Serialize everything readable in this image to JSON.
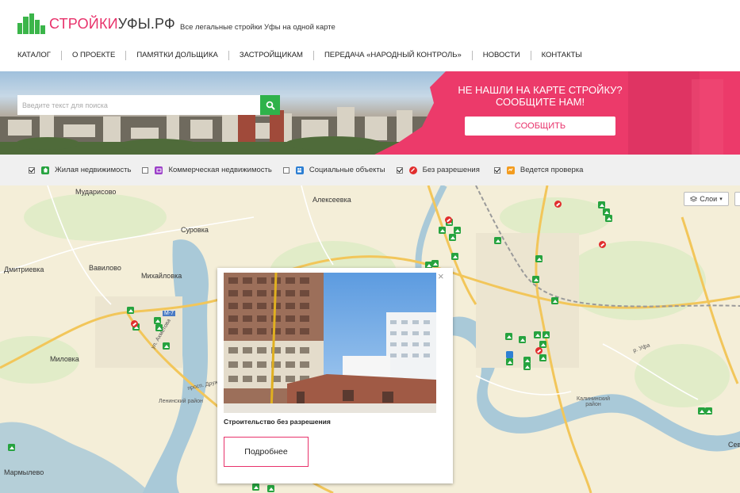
{
  "header": {
    "logo_part1": "СТРОЙКИ",
    "logo_part2": "УФЫ.РФ",
    "tagline": "Все легальные стройки Уфы на одной карте"
  },
  "nav": [
    {
      "label": "КАТАЛОГ"
    },
    {
      "label": "О ПРОЕКТЕ"
    },
    {
      "label": "ПАМЯТКИ ДОЛЬЩИКА"
    },
    {
      "label": "ЗАСТРОЙЩИКАМ"
    },
    {
      "label": "ПЕРЕДАЧА «НАРОДНЫЙ КОНТРОЛЬ»"
    },
    {
      "label": "НОВОСТИ"
    },
    {
      "label": "КОНТАКТЫ"
    }
  ],
  "search": {
    "placeholder": "Введите текст для поиска",
    "icon": "search-icon"
  },
  "promo": {
    "title": "НЕ НАШЛИ НА КАРТЕ СТРОЙКУ? СООБЩИТЕ НАМ!",
    "button": "СООБЩИТЬ"
  },
  "filters": [
    {
      "label": "Жилая недвижимость",
      "checked": true,
      "icon": "house-icon",
      "color": "#26a33f"
    },
    {
      "label": "Коммерческая недвижимость",
      "checked": false,
      "icon": "shop-icon",
      "color": "#9b3fc8"
    },
    {
      "label": "Социальные объекты",
      "checked": false,
      "icon": "people-icon",
      "color": "#2d7fd3"
    },
    {
      "label": "Без разрешения",
      "checked": true,
      "icon": "forbidden-icon",
      "color": "#e12e2e"
    },
    {
      "label": "Ведется проверка",
      "checked": true,
      "icon": "inspection-icon",
      "color": "#f39c1f"
    }
  ],
  "map": {
    "layers_button": "Слои",
    "places": [
      "Мударисово",
      "Алексеевка",
      "Суровка",
      "Дмитриевка",
      "Вавилово",
      "Михайловка",
      "Миловка",
      "Мармылево",
      "Калининский район",
      "Ленинский район",
      "М-7",
      "просп. Дружбы",
      "ул. Ахметова",
      "р. Уфа",
      "Сев"
    ]
  },
  "popup": {
    "caption": "Строительство без разрешения",
    "button": "Подробнее",
    "close": "×"
  },
  "colors": {
    "brand_pink": "#e8326b",
    "brand_green": "#2fb24a",
    "map_bg": "#f4eed8",
    "river": "#a9c9d8"
  }
}
